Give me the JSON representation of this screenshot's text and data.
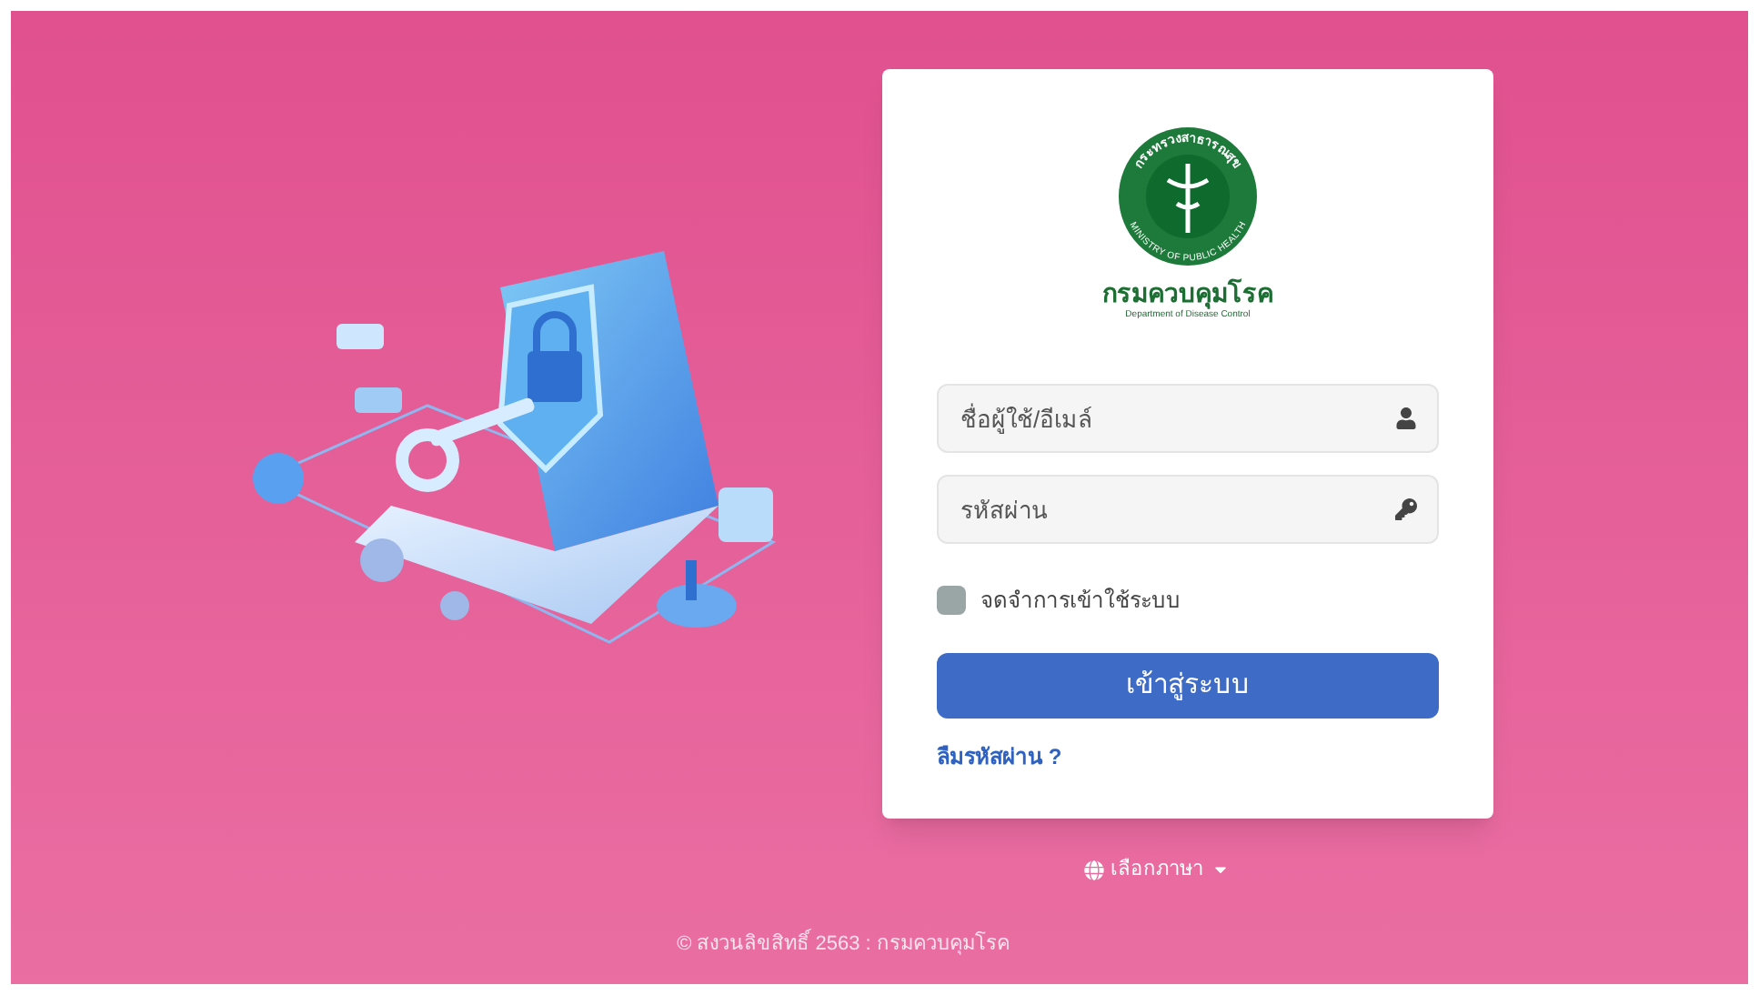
{
  "logo": {
    "ring_top": "กระทรวงสาธารณสุข",
    "ring_bottom": "MINISTRY OF PUBLIC HEALTH",
    "name": "กรมควบคุมโรค",
    "name_en": "Department of Disease Control"
  },
  "form": {
    "username": {
      "placeholder": "ชื่อผู้ใช้/อีเมล์"
    },
    "password": {
      "placeholder": "รหัสผ่าน"
    },
    "remember": {
      "label": "จดจำการเข้าใช้ระบบ",
      "checked": false
    },
    "submit": "เข้าสู่ระบบ",
    "forgot": "ลืมรหัสผ่าน ?"
  },
  "language": {
    "label": "เลือกภาษา"
  },
  "footer": "© สงวนลิขสิทธิ์ 2563 : กรมควบคุมโรค"
}
